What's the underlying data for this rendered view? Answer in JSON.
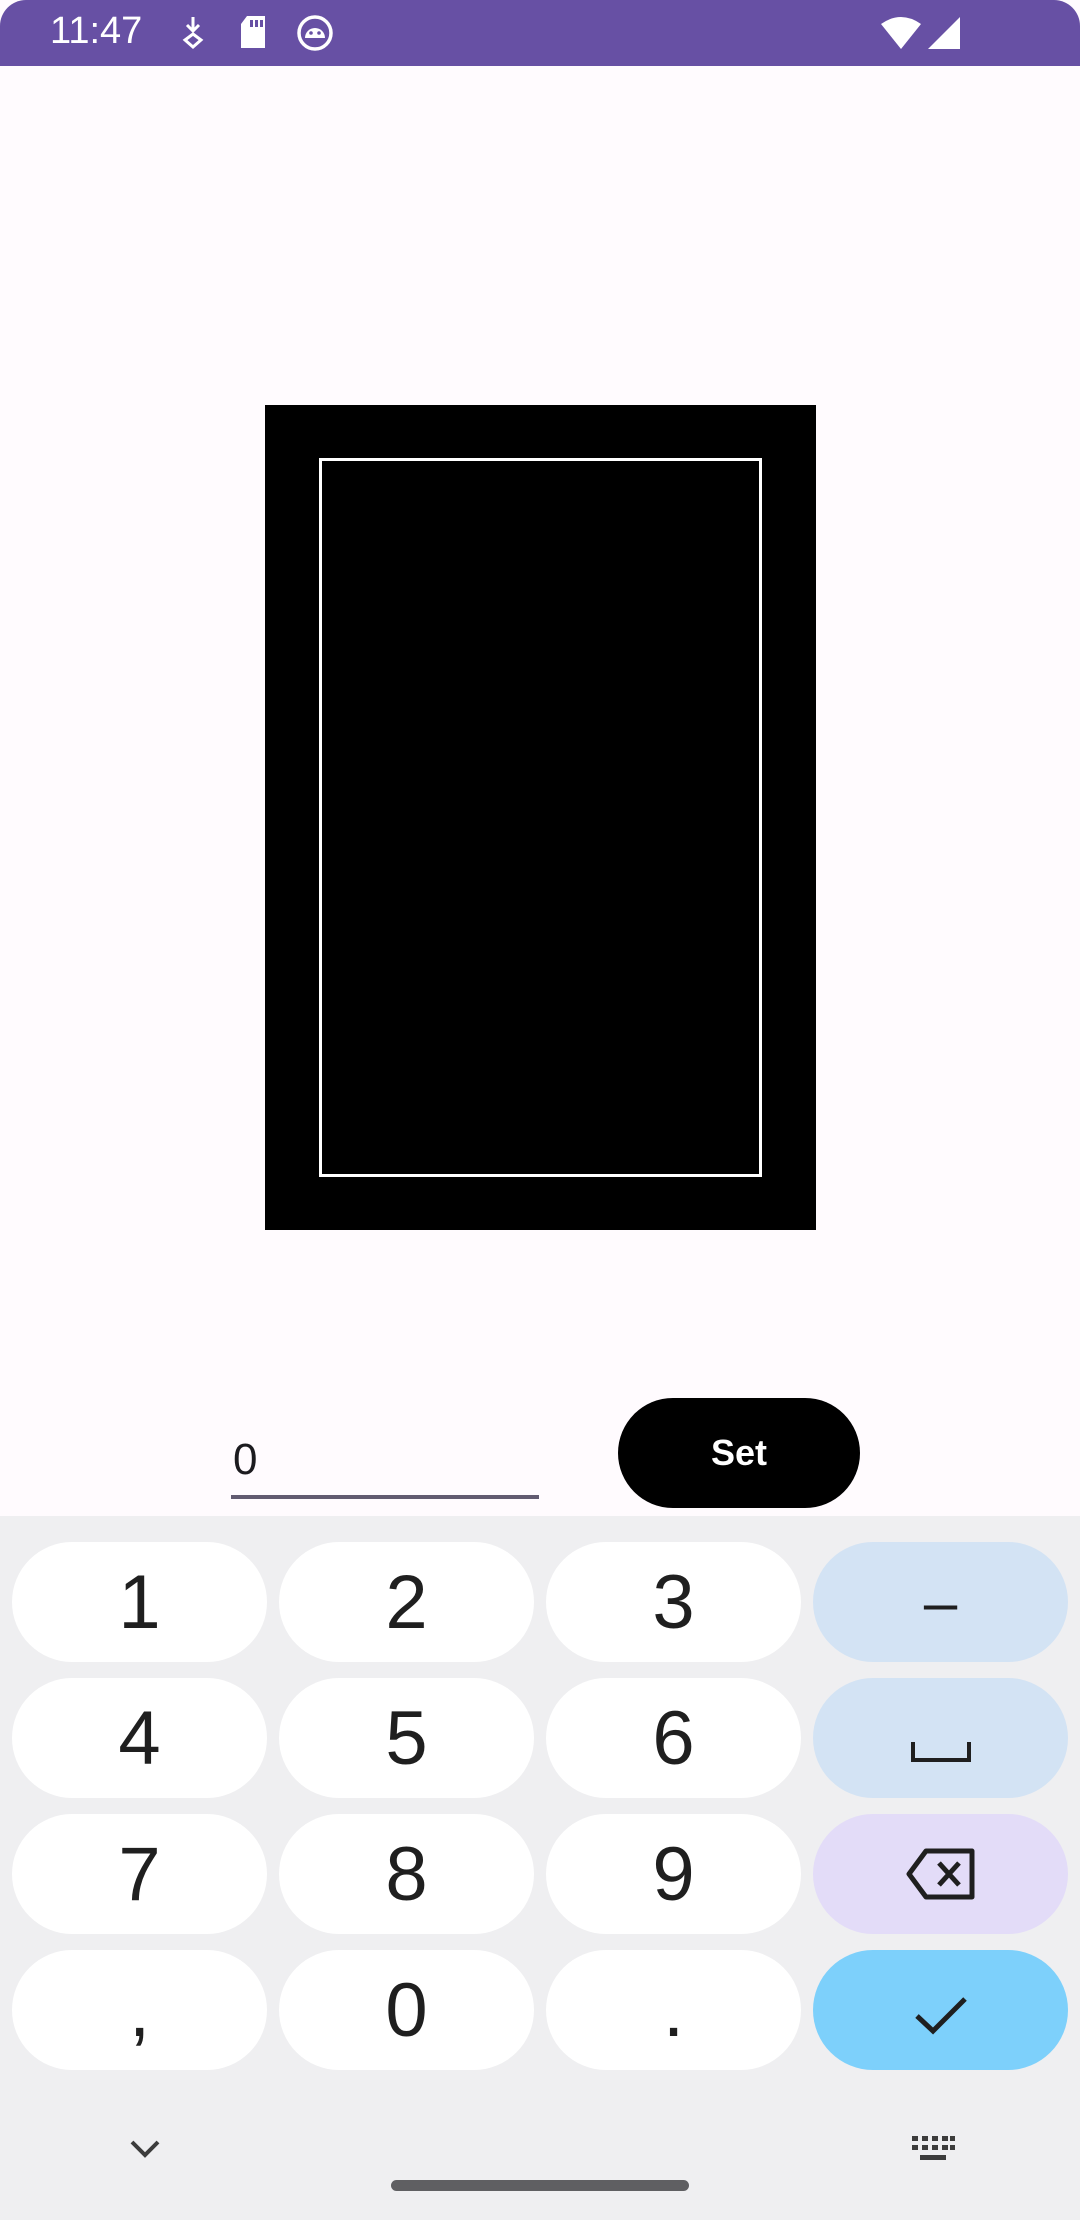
{
  "status_bar": {
    "time": "11:47",
    "icons": [
      "download-icon",
      "sd-card-icon",
      "android-debug-icon",
      "wifi-icon",
      "signal-icon"
    ]
  },
  "form": {
    "input_value": "0",
    "set_label": "Set"
  },
  "keyboard": {
    "rows": [
      [
        "1",
        "2",
        "3",
        "–"
      ],
      [
        "4",
        "5",
        "6",
        "space"
      ],
      [
        "7",
        "8",
        "9",
        "backspace"
      ],
      [
        ",",
        "0",
        ".",
        "enter"
      ]
    ],
    "nav_icons": [
      "chevron-down-icon",
      "keyboard-icon"
    ]
  },
  "colors": {
    "status_bar": "#6750a4",
    "background": "#fffbfe",
    "key": "#ffffff",
    "function_key": "#d3e3f4",
    "backspace_key": "#e3dcf8",
    "enter_key": "#7dd0fb"
  }
}
